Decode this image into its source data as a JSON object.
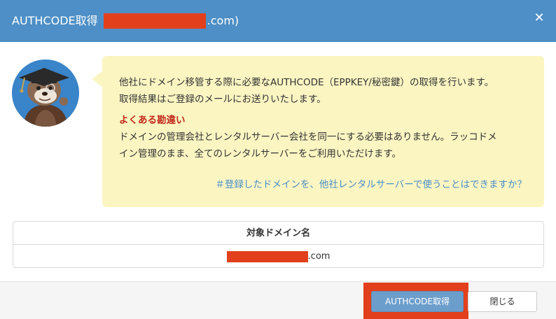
{
  "header": {
    "title_prefix": "AUTHCODE取得",
    "title_suffix": ".com)",
    "close_symbol": "✕"
  },
  "notice": {
    "line1": "他社にドメイン移管する際に必要なAUTHCODE（EPPKEY/秘密鍵）の取得を行います。",
    "line2": "取得結果はご登録のメールにお送りいたします。",
    "warning_title": "よくある勘違い",
    "warning_line1": "ドメインの管理会社とレンタルサーバー会社を同一にする必要はありません。ラッコドメ",
    "warning_line2": "イン管理のまま、全てのレンタルサーバーをご利用いただけます。",
    "faq_link": "＃登録したドメインを、他社レンタルサーバーで使うことはできますか？"
  },
  "table": {
    "header": "対象ドメイン名",
    "domain_suffix": ".com"
  },
  "footer": {
    "primary_label": "AUTHCODE取得",
    "secondary_label": "閉じる"
  },
  "colors": {
    "header_bg": "#4d8fc6",
    "bubble_bg": "#fbf5c2",
    "warning": "#c1281b",
    "link": "#4a8fc8",
    "redaction": "#e2401c",
    "primary_button": "#6c9ecc"
  },
  "icons": {
    "avatar": "sea-otter-graduate-mascot",
    "close": "close-icon"
  }
}
